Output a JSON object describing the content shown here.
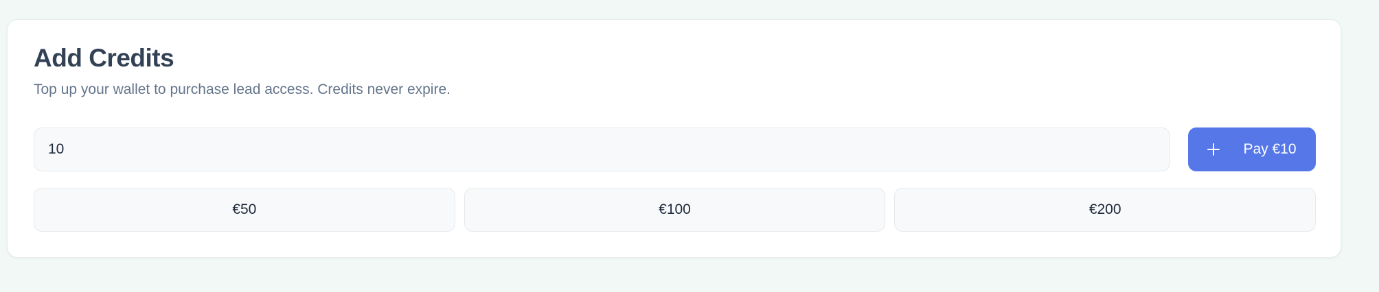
{
  "add_credits": {
    "title": "Add Credits",
    "subtitle": "Top up your wallet to purchase lead access. Credits never expire.",
    "amount_input": {
      "value": "10",
      "placeholder": ""
    },
    "pay_button": {
      "icon": "plus-icon",
      "label": "Pay €10"
    },
    "presets": [
      {
        "label": "€50"
      },
      {
        "label": "€100"
      },
      {
        "label": "€200"
      }
    ]
  },
  "colors": {
    "background": "#f1f8f6",
    "card": "#ffffff",
    "primary": "#5677e8",
    "title": "#334155",
    "subtitle": "#64748b",
    "input_background": "#f8f9fa"
  }
}
